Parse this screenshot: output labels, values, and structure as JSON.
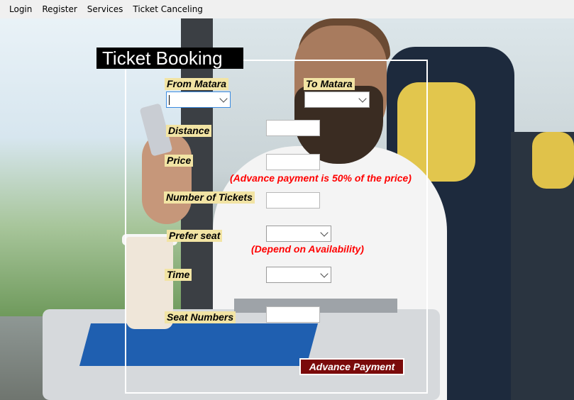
{
  "menu": {
    "items": [
      "Login",
      "Register",
      "Services",
      "Ticket Canceling"
    ]
  },
  "form": {
    "title": "Ticket Booking",
    "labels": {
      "from": "From Matara",
      "to": "To Matara",
      "distance": "Distance",
      "price": "Price",
      "tickets": "Number of Tickets",
      "prefer_seat": "Prefer seat",
      "time": "Time",
      "seat_numbers": "Seat Numbers"
    },
    "values": {
      "from": "",
      "to": "",
      "distance": "",
      "price": "",
      "tickets": "",
      "prefer_seat": "",
      "time": "",
      "seat_numbers": ""
    },
    "notes": {
      "advance": "(Advance payment is 50% of the price)",
      "availability": "(Depend on Availability)"
    },
    "button": "Advance Payment"
  },
  "colors": {
    "label_bg": "#f2e4a4",
    "note": "#ff0000",
    "button_bg": "#7a0a0a",
    "title_bg": "#000000"
  }
}
